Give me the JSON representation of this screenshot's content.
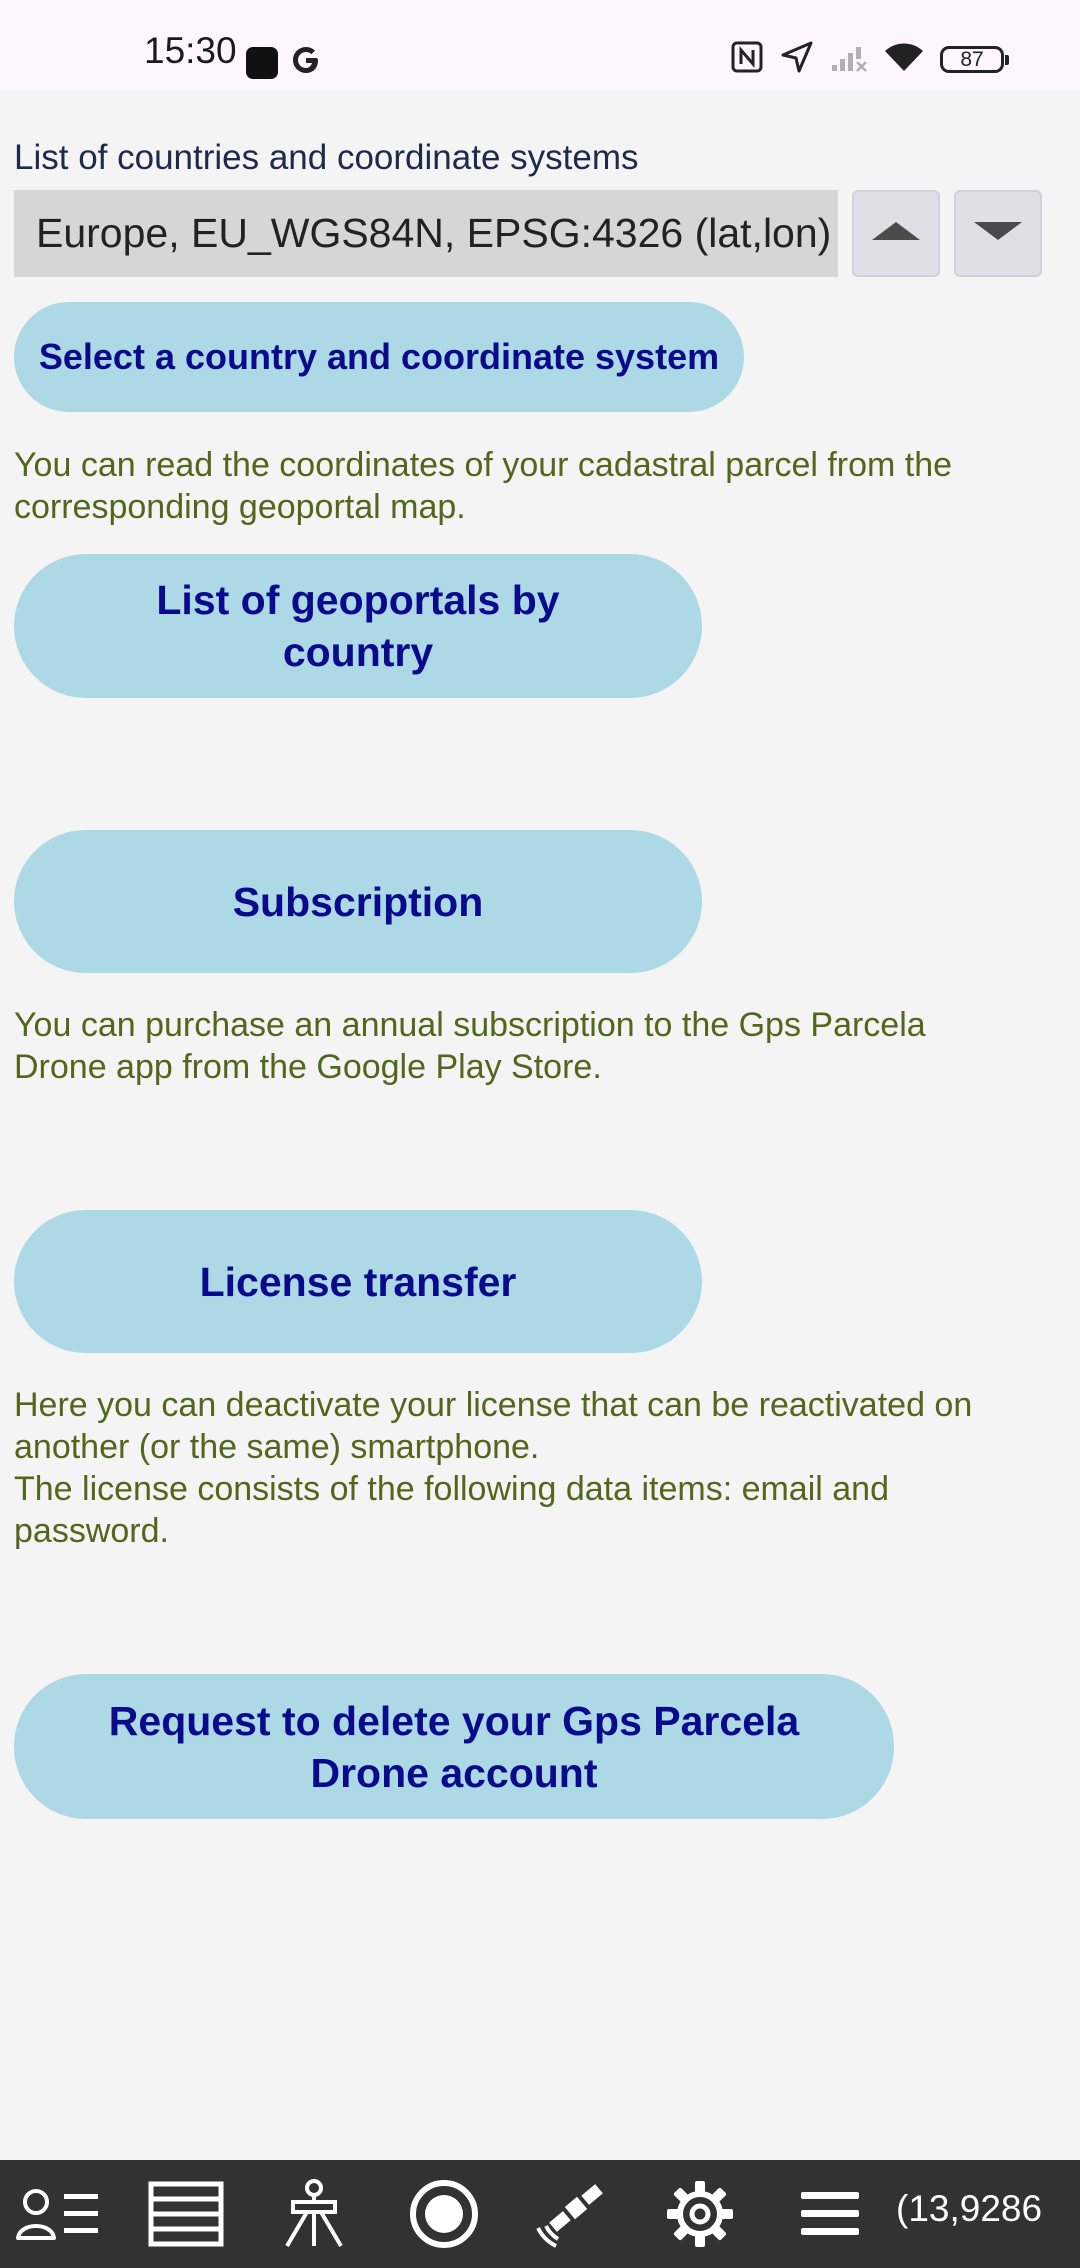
{
  "status_bar": {
    "time": "15:30",
    "battery_level": "87",
    "left_icons": [
      "notification-square-icon",
      "google-g-icon"
    ],
    "right_icons": [
      "nfc-icon",
      "location-arrow-icon",
      "no-signal-icon",
      "wifi-icon",
      "battery-icon"
    ]
  },
  "coordinate_section": {
    "label": "List of countries and coordinate systems",
    "selected_value": "Europe, EU_WGS84N, EPSG:4326 (lat,lon)",
    "up_icon": "triangle-up-icon",
    "down_icon": "triangle-down-icon"
  },
  "buttons": {
    "select_country": "Select a country and coordinate system",
    "geoportals": "List of geoportals by\ncountry",
    "subscription": "Subscription",
    "license_transfer": "License transfer",
    "delete_account": "Request to delete your Gps Parcela\nDrone account"
  },
  "texts": {
    "geoportal_info": "You can read the coordinates of your cadastral parcel from the\ncorresponding geoportal map.",
    "subscription_info": "You can purchase an annual subscription to the Gps Parcela\nDrone app from the Google Play Store.",
    "license_info": "Here you can deactivate your license that can be reactivated on\nanother (or the same) smartphone.\nThe license consists of the following data items: email and\npassword."
  },
  "toolbar": {
    "icons": [
      "user-list-icon",
      "layers-list-icon",
      "surveyor-tripod-icon",
      "record-circle-icon",
      "satellite-icon",
      "settings-gear-icon",
      "menu-icon"
    ],
    "coordinates_readout": "(13,9286"
  },
  "colors": {
    "button_bg": "#add8e6",
    "button_text": "#0a0a8c",
    "info_text": "#52661c",
    "toolbar_bg": "#323232",
    "page_bg": "#f4f4f4"
  }
}
